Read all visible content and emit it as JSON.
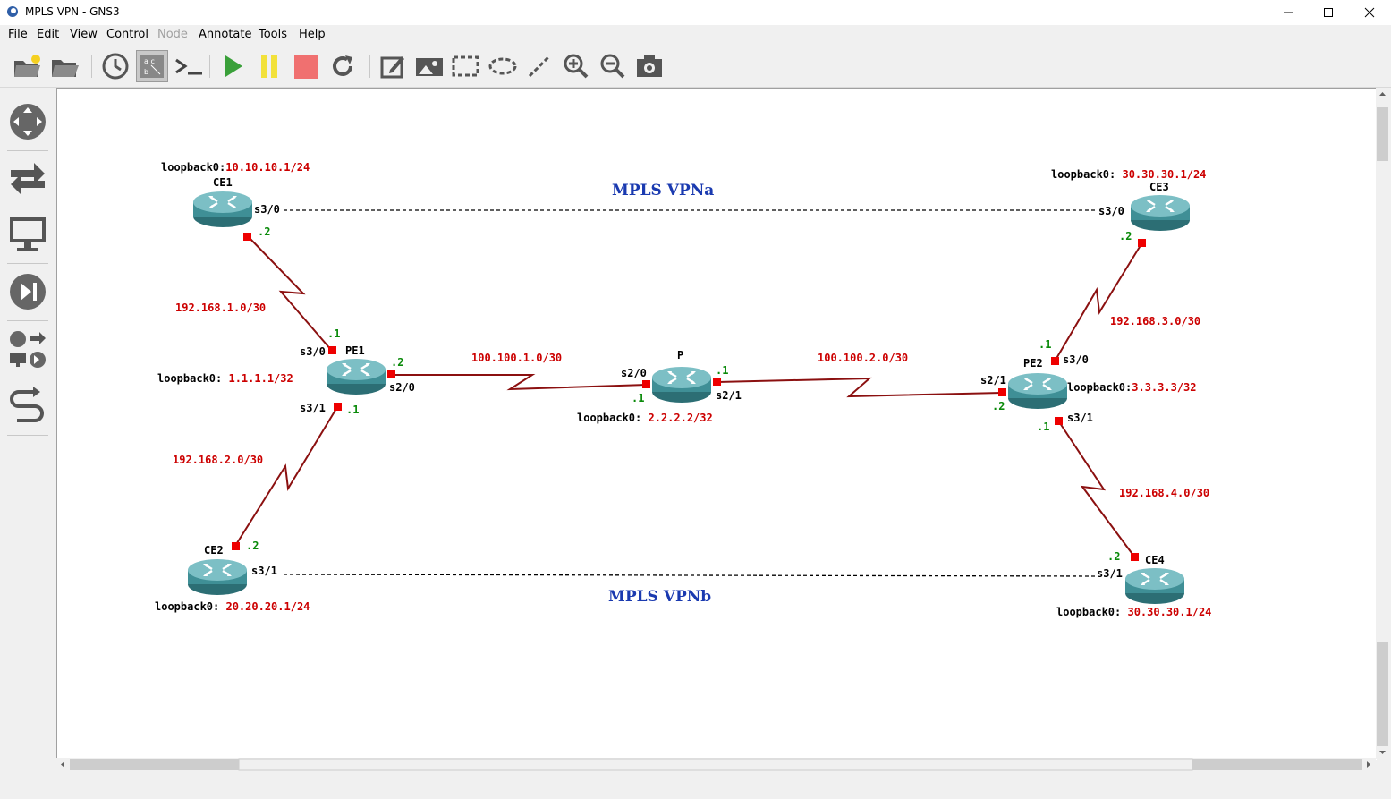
{
  "window": {
    "title": "MPLS VPN - GNS3"
  },
  "menu": [
    {
      "label": "File",
      "enabled": true
    },
    {
      "label": "Edit",
      "enabled": true
    },
    {
      "label": "View",
      "enabled": true
    },
    {
      "label": "Control",
      "enabled": true
    },
    {
      "label": "Node",
      "enabled": false
    },
    {
      "label": "Annotate",
      "enabled": true
    },
    {
      "label": "Tools",
      "enabled": true
    },
    {
      "label": "Help",
      "enabled": true
    }
  ],
  "toolbar": [
    "new-project-icon",
    "open-project-icon",
    "snapshot-clock-icon",
    "show-interface-labels-icon",
    "console-icon",
    "start-all-icon",
    "suspend-all-icon",
    "stop-all-icon",
    "reload-all-icon",
    "add-note-icon",
    "insert-image-icon",
    "draw-rectangle-icon",
    "draw-ellipse-icon",
    "draw-line-icon",
    "zoom-in-icon",
    "zoom-out-icon",
    "screenshot-icon"
  ],
  "sidebar": [
    "browse-routers-icon",
    "browse-switches-icon",
    "browse-end-devices-icon",
    "browse-security-devices-icon",
    "browse-all-devices-icon",
    "add-link-icon"
  ],
  "colors": {
    "link": "#8b1010",
    "red_label": "#cc0000",
    "green_label": "#0a8a0a",
    "blue_title": "#1a3ab0",
    "router_body": "#3f8f96"
  },
  "topology": {
    "routers": {
      "ce1": {
        "name": "CE1",
        "loopback_key": "loopback0:",
        "loopback_val": "10.10.10.1/24"
      },
      "ce2": {
        "name": "CE2",
        "loopback_key": "loopback0:",
        "loopback_val": " 20.20.20.1/24"
      },
      "ce3": {
        "name": "CE3",
        "loopback_key": "loopback0:",
        "loopback_val": " 30.30.30.1/24"
      },
      "ce4": {
        "name": "CE4",
        "loopback_key": "loopback0:",
        "loopback_val": " 30.30.30.1/24"
      },
      "pe1": {
        "name": "PE1",
        "loopback_key": "loopback0:",
        "loopback_val": " 1.1.1.1/32"
      },
      "pe2": {
        "name": "PE2",
        "loopback_key": "loopback0:",
        "loopback_val": "3.3.3.3/32"
      },
      "p": {
        "name": "P",
        "loopback_key": "loopback0:",
        "loopback_val": " 2.2.2.2/32"
      }
    },
    "subnets": {
      "ce1_pe1": "192.168.1.0/30",
      "ce2_pe1": "192.168.2.0/30",
      "ce3_pe2": "192.168.3.0/30",
      "ce4_pe2": "192.168.4.0/30",
      "pe1_p": "100.100.1.0/30",
      "p_pe2": "100.100.2.0/30"
    },
    "interfaces": {
      "ce1_s30": "s3/0",
      "ce3_s30": "s3/0",
      "ce2_s31": "s3/1",
      "ce4_s31": "s3/1",
      "pe1_s30": "s3/0",
      "pe1_s20": "s2/0",
      "pe1_s31": "s3/1",
      "p_s20": "s2/0",
      "p_s21": "s2/1",
      "pe2_s21": "s2/1",
      "pe2_s30": "s3/0",
      "pe2_s31": "s3/1"
    },
    "hosts": {
      "dot1": ".1",
      "dot2": ".2"
    },
    "annotations": {
      "vpn_a": "MPLS VPNa",
      "vpn_b": "MPLS VPNb"
    }
  }
}
